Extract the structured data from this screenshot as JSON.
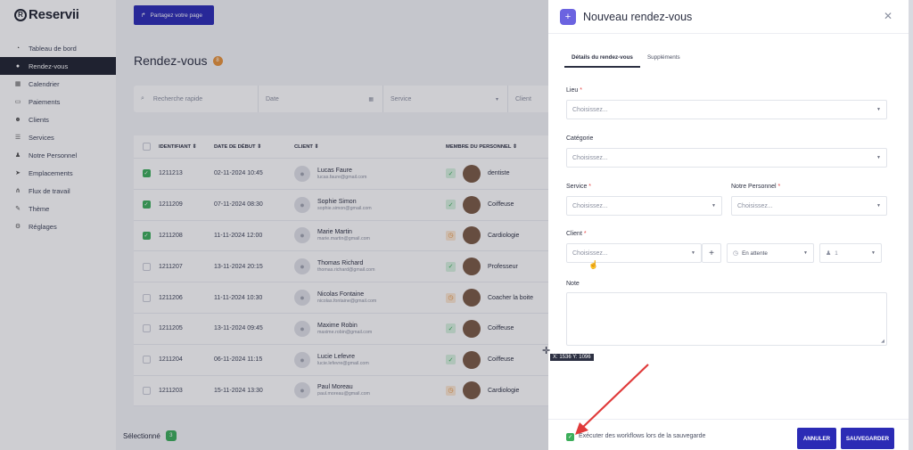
{
  "sidebar": {
    "logo": "Reservii",
    "items": [
      {
        "label": "Tableau de bord",
        "icon": "dashboard-icon"
      },
      {
        "label": "Rendez-vous",
        "icon": "clock-icon",
        "active": true
      },
      {
        "label": "Calendrier",
        "icon": "calendar-icon"
      },
      {
        "label": "Paiements",
        "icon": "payment-icon"
      },
      {
        "label": "Clients",
        "icon": "users-icon"
      },
      {
        "label": "Services",
        "icon": "list-icon"
      },
      {
        "label": "Notre Personnel",
        "icon": "person-icon"
      },
      {
        "label": "Emplacements",
        "icon": "location-icon"
      },
      {
        "label": "Flux de travail",
        "icon": "workflow-icon"
      },
      {
        "label": "Thème",
        "icon": "brush-icon"
      },
      {
        "label": "Réglages",
        "icon": "gear-icon"
      }
    ]
  },
  "header": {
    "share_label": "Partagez votre page"
  },
  "page": {
    "title": "Rendez-vous",
    "count": "8"
  },
  "filters": {
    "search": "Recherche rapide",
    "date": "Date",
    "service": "Service",
    "client": "Client"
  },
  "table": {
    "headers": {
      "id": "IDENTIFIANT ⇕",
      "date": "DATE DE DÉBUT ⇕",
      "client": "CLIENT ⇕",
      "staff": "MEMBRE DU PERSONNEL ⇕"
    },
    "rows": [
      {
        "id": "1211213",
        "date": "02-11-2024 10:45",
        "name": "Lucas Faure",
        "email": "lucas.faure@gmail.com",
        "status": "ok",
        "staff": "dentiste",
        "checked": true
      },
      {
        "id": "1211209",
        "date": "07-11-2024 08:30",
        "name": "Sophie Simon",
        "email": "sophie.simon@gmail.com",
        "status": "ok",
        "staff": "Coiffeuse",
        "checked": true
      },
      {
        "id": "1211208",
        "date": "11-11-2024 12:00",
        "name": "Marie Martin",
        "email": "marie.martin@gmail.com",
        "status": "wait",
        "staff": "Cardiologie",
        "checked": true
      },
      {
        "id": "1211207",
        "date": "13-11-2024 20:15",
        "name": "Thomas Richard",
        "email": "thomas.richard@gmail.com",
        "status": "ok",
        "staff": "Professeur",
        "checked": false
      },
      {
        "id": "1211206",
        "date": "11-11-2024 10:30",
        "name": "Nicolas Fontaine",
        "email": "nicolas.fontaine@gmail.com",
        "status": "wait",
        "staff": "Coacher la boite",
        "checked": false
      },
      {
        "id": "1211205",
        "date": "13-11-2024 09:45",
        "name": "Maxime Robin",
        "email": "maxime.robin@gmail.com",
        "status": "ok",
        "staff": "Coiffeuse",
        "checked": false
      },
      {
        "id": "1211204",
        "date": "06-11-2024 11:15",
        "name": "Lucie Lefevre",
        "email": "lucie.lefevre@gmail.com",
        "status": "ok",
        "staff": "Coiffeuse",
        "checked": false
      },
      {
        "id": "1211203",
        "date": "15-11-2024 13:30",
        "name": "Paul Moreau",
        "email": "paul.moreau@gmail.com",
        "status": "wait",
        "staff": "Cardiologie",
        "checked": false
      }
    ]
  },
  "footer": {
    "selected_label": "Sélectionné",
    "selected_count": "3"
  },
  "modal": {
    "title": "Nouveau rendez-vous",
    "tabs": [
      "Détails du rendez-vous",
      "Suppléments"
    ],
    "lieu_label": "Lieu",
    "categorie_label": "Catégorie",
    "service_label": "Service",
    "personnel_label": "Notre Personnel",
    "client_label": "Client",
    "note_label": "Note",
    "placeholder": "Choisissez...",
    "status_value": "En attente",
    "people_value": "1",
    "workflow_label": "Exécuter des workflows lors de la sauvegarde",
    "cancel_label": "ANNULER",
    "save_label": "SAUVEGARDER"
  },
  "cursor_readout": "X: 1536 Y: 1096",
  "colors": {
    "primary": "#2b2bb5",
    "accent": "#6b63e0",
    "success": "#3cae5a",
    "warning": "#e7923a",
    "annotation": "#e03a3a"
  }
}
